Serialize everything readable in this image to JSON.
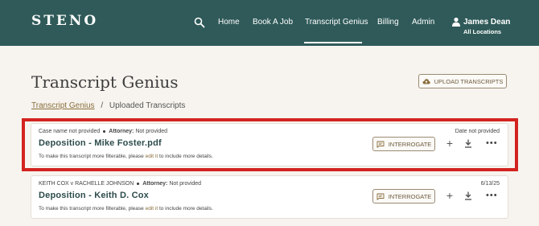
{
  "app": {
    "logo": "STENO",
    "nav": [
      "Home",
      "Book A Job",
      "Transcript Genius",
      "Billing",
      "Admin"
    ],
    "active_nav": "Transcript Genius",
    "user": {
      "name": "James Dean",
      "location": "All Locations"
    },
    "colors": {
      "header_bg": "#2f5a59",
      "accent": "#8a6d3b",
      "highlight": "#d32320"
    }
  },
  "page": {
    "title": "Transcript Genius",
    "upload_button": "UPLOAD TRANSCRIPTS",
    "breadcrumb": {
      "root": "Transcript Genius",
      "separator": "/",
      "current": "Uploaded Transcripts"
    }
  },
  "transcripts": [
    {
      "case": "Case name not provided",
      "attorney_label": "Attorney:",
      "attorney": "Not provided",
      "date": "Date not provided",
      "title": "Deposition - Mike Foster.pdf",
      "hint_pre": "To make this transcript more filterable, please",
      "hint_link": "edit it",
      "hint_post": "to include more details.",
      "interrogate_label": "INTERROGATE",
      "highlighted": true
    },
    {
      "case": "KEITH COX v RACHELLE JOHNSON",
      "attorney_label": "Attorney:",
      "attorney": "Not provided",
      "date": "6/13/25",
      "title": "Deposition - Keith D. Cox",
      "hint_pre": "To make this transcript more filterable, please",
      "hint_link": "edit it",
      "hint_post": "to include more details.",
      "interrogate_label": "INTERROGATE",
      "highlighted": false
    }
  ]
}
